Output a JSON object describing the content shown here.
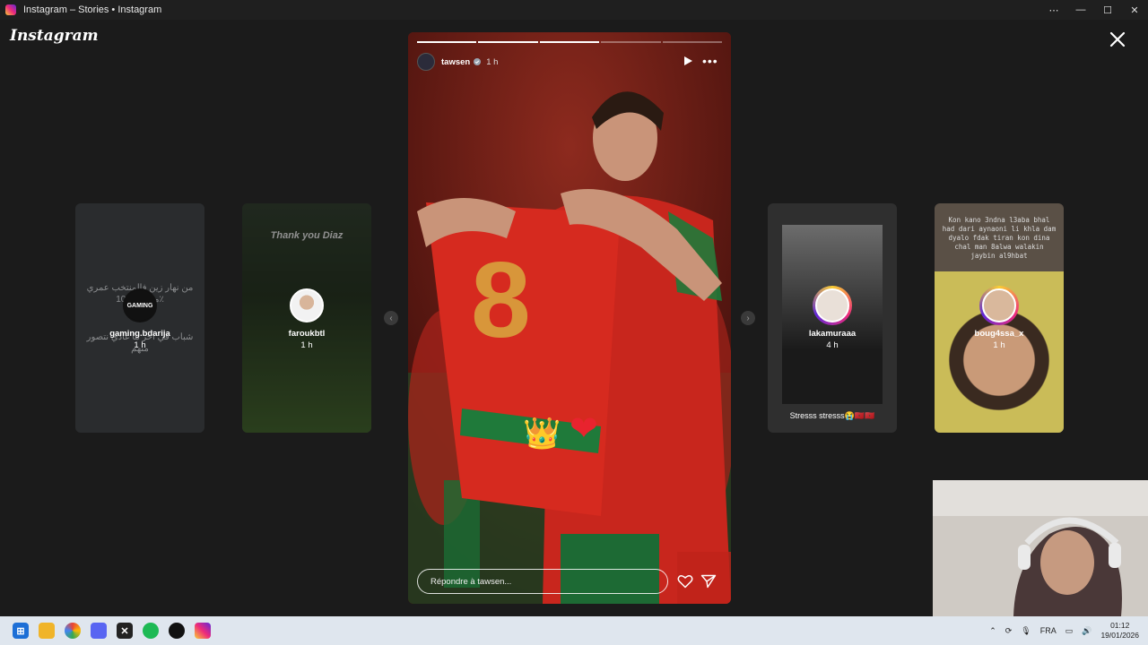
{
  "window": {
    "title": "Instagram – Stories • Instagram",
    "controls": [
      "⋯",
      "—",
      "☐",
      "✕"
    ]
  },
  "header": {
    "logo": "Instagram"
  },
  "side_stories": [
    {
      "username": "gaming.bdarija",
      "time": "1 h",
      "avatar_text": "GAMING",
      "text_top": "من نهار زين فالمنتخب عمري ما كنت 100٪",
      "text_bottom": "شباب في آخر ما غادي نتصور منهم"
    },
    {
      "username": "faroukbtl",
      "time": "1 h",
      "title": "Thank you Diaz"
    },
    {
      "username": "lakamuraaa",
      "time": "4 h",
      "caption": "Stresss stresss😭🇲🇦🇲🇦"
    },
    {
      "username": "boug4ssa_x",
      "time": "1 h",
      "text": "Kon kano 3ndna l3aba bhal had dari aynaoni li khla dam dyalo fdak tiran kon dina chal man 8alwa walakin jaybin al9hbat"
    }
  ],
  "main_story": {
    "username": "tawsen",
    "time": "1 h",
    "progress": [
      1,
      1,
      1,
      0,
      0
    ],
    "emoji_crown": "👑",
    "emoji_heart": "❤",
    "reply_placeholder": "Répondre à tawsen..."
  },
  "taskbar": {
    "tray": [
      "FRA"
    ],
    "time": "01:12",
    "date": "19/01/2026"
  },
  "colors": {
    "instagram_gradient": [
      "#f9ce34",
      "#ee2a7b",
      "#6228d7"
    ],
    "stage_bg": "#1b1b1b",
    "jersey_red": "#c8261d",
    "jersey_green": "#1f7a3a"
  },
  "icons": [
    "search-icon",
    "close-icon",
    "play-icon",
    "more-icon",
    "heart-icon",
    "send-icon",
    "verified-icon",
    "chevron-left-icon",
    "chevron-right-icon"
  ]
}
